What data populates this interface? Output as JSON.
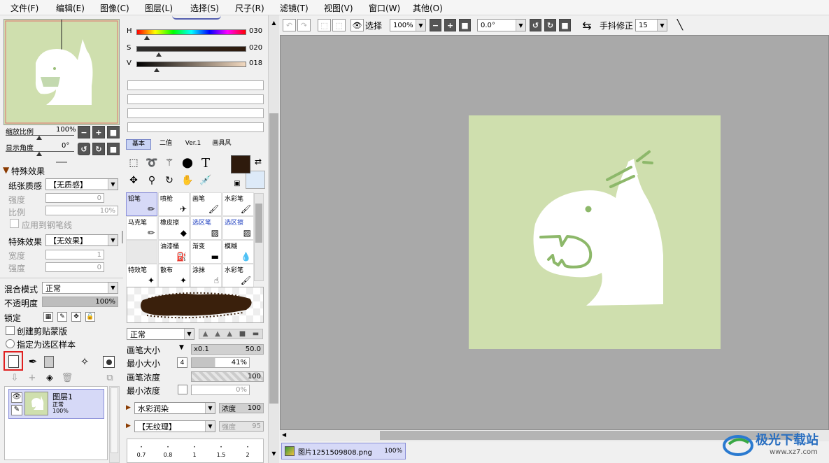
{
  "menu": [
    "文件(F)",
    "编辑(E)",
    "图像(C)",
    "图层(L)",
    "选择(S)",
    "尺子(R)",
    "滤镜(T)",
    "视图(V)",
    "窗口(W)",
    "其他(O)"
  ],
  "navigator": {
    "zoom_label": "缩放比例",
    "zoom_value": "100%",
    "angle_label": "显示角度",
    "angle_value": "0°"
  },
  "effects": {
    "header": "特殊效果",
    "paper_label": "纸张质感",
    "paper_value": "【无质感】",
    "strength_label": "强度",
    "strength_value": "0",
    "ratio_label": "比例",
    "ratio_value": "10%",
    "apply_label": "应用到钢笔线",
    "effect_label": "特殊效果",
    "effect_value": "【无效果】",
    "width_label": "宽度",
    "width_value": "1",
    "strength2_label": "强度",
    "strength2_value": "0"
  },
  "layer": {
    "blend_label": "混合模式",
    "blend_value": "正常",
    "opacity_label": "不透明度",
    "opacity_value": "100%",
    "lock_label": "锁定",
    "clip_label": "创建剪贴蒙版",
    "sample_label": "指定为选区样本",
    "name": "图层1",
    "mode": "正常",
    "opacity": "100%"
  },
  "color": {
    "h_label": "H",
    "h_value": "030",
    "s_label": "S",
    "s_value": "020",
    "v_label": "V",
    "v_value": "018",
    "fg": "#2e1a0c",
    "bg": "#ddeaf8"
  },
  "tool_tabs": [
    "基本",
    "二值",
    "Ver.1",
    "画具风"
  ],
  "brushes": [
    {
      "label": "铅笔",
      "icon": "✏"
    },
    {
      "label": "喷枪",
      "icon": "✈"
    },
    {
      "label": "画笔",
      "icon": "🖌"
    },
    {
      "label": "水彩笔",
      "icon": "🖌"
    },
    {
      "label": "马克笔",
      "icon": "✏"
    },
    {
      "label": "橡皮擦",
      "icon": "◆"
    },
    {
      "label": "选区笔",
      "icon": "▨"
    },
    {
      "label": "选区擦",
      "icon": "▨"
    },
    {
      "label": "",
      "icon": ""
    },
    {
      "label": "油漆桶",
      "icon": "⛽"
    },
    {
      "label": "渐变",
      "icon": "▬"
    },
    {
      "label": "模糊",
      "icon": "💧"
    },
    {
      "label": "特效笔",
      "icon": "✦"
    },
    {
      "label": "散布",
      "icon": "✦"
    },
    {
      "label": "涂抹",
      "icon": "☝"
    },
    {
      "label": "水彩笔",
      "icon": "🖌"
    }
  ],
  "brush_settings": {
    "mode_value": "正常",
    "size_label": "画笔大小",
    "size_mult": "x0.1",
    "size_value": "50.0",
    "min_size_label": "最小大小",
    "min_size_value": "41%",
    "density_label": "画笔浓度",
    "density_value": "100",
    "min_density_label": "最小浓度",
    "min_density_value": "0%",
    "blend_value": "水彩润染",
    "blend_density_label": "浓度",
    "blend_density_value": "100",
    "texture_value": "【无纹理】",
    "texture_density_label": "强度",
    "texture_density_value": "95"
  },
  "size_presets": [
    "0.7",
    "0.8",
    "1",
    "1.5",
    "2"
  ],
  "toolbar": {
    "select_label": "选择",
    "zoom_value": "100%",
    "angle_value": "0.0°",
    "stabilizer_label": "手抖修正",
    "stabilizer_value": "15"
  },
  "file_tab": {
    "name": "图片1251509808.png",
    "zoom": "100%"
  },
  "watermark": {
    "text": "极光下载站",
    "url": "www.xz7.com"
  }
}
